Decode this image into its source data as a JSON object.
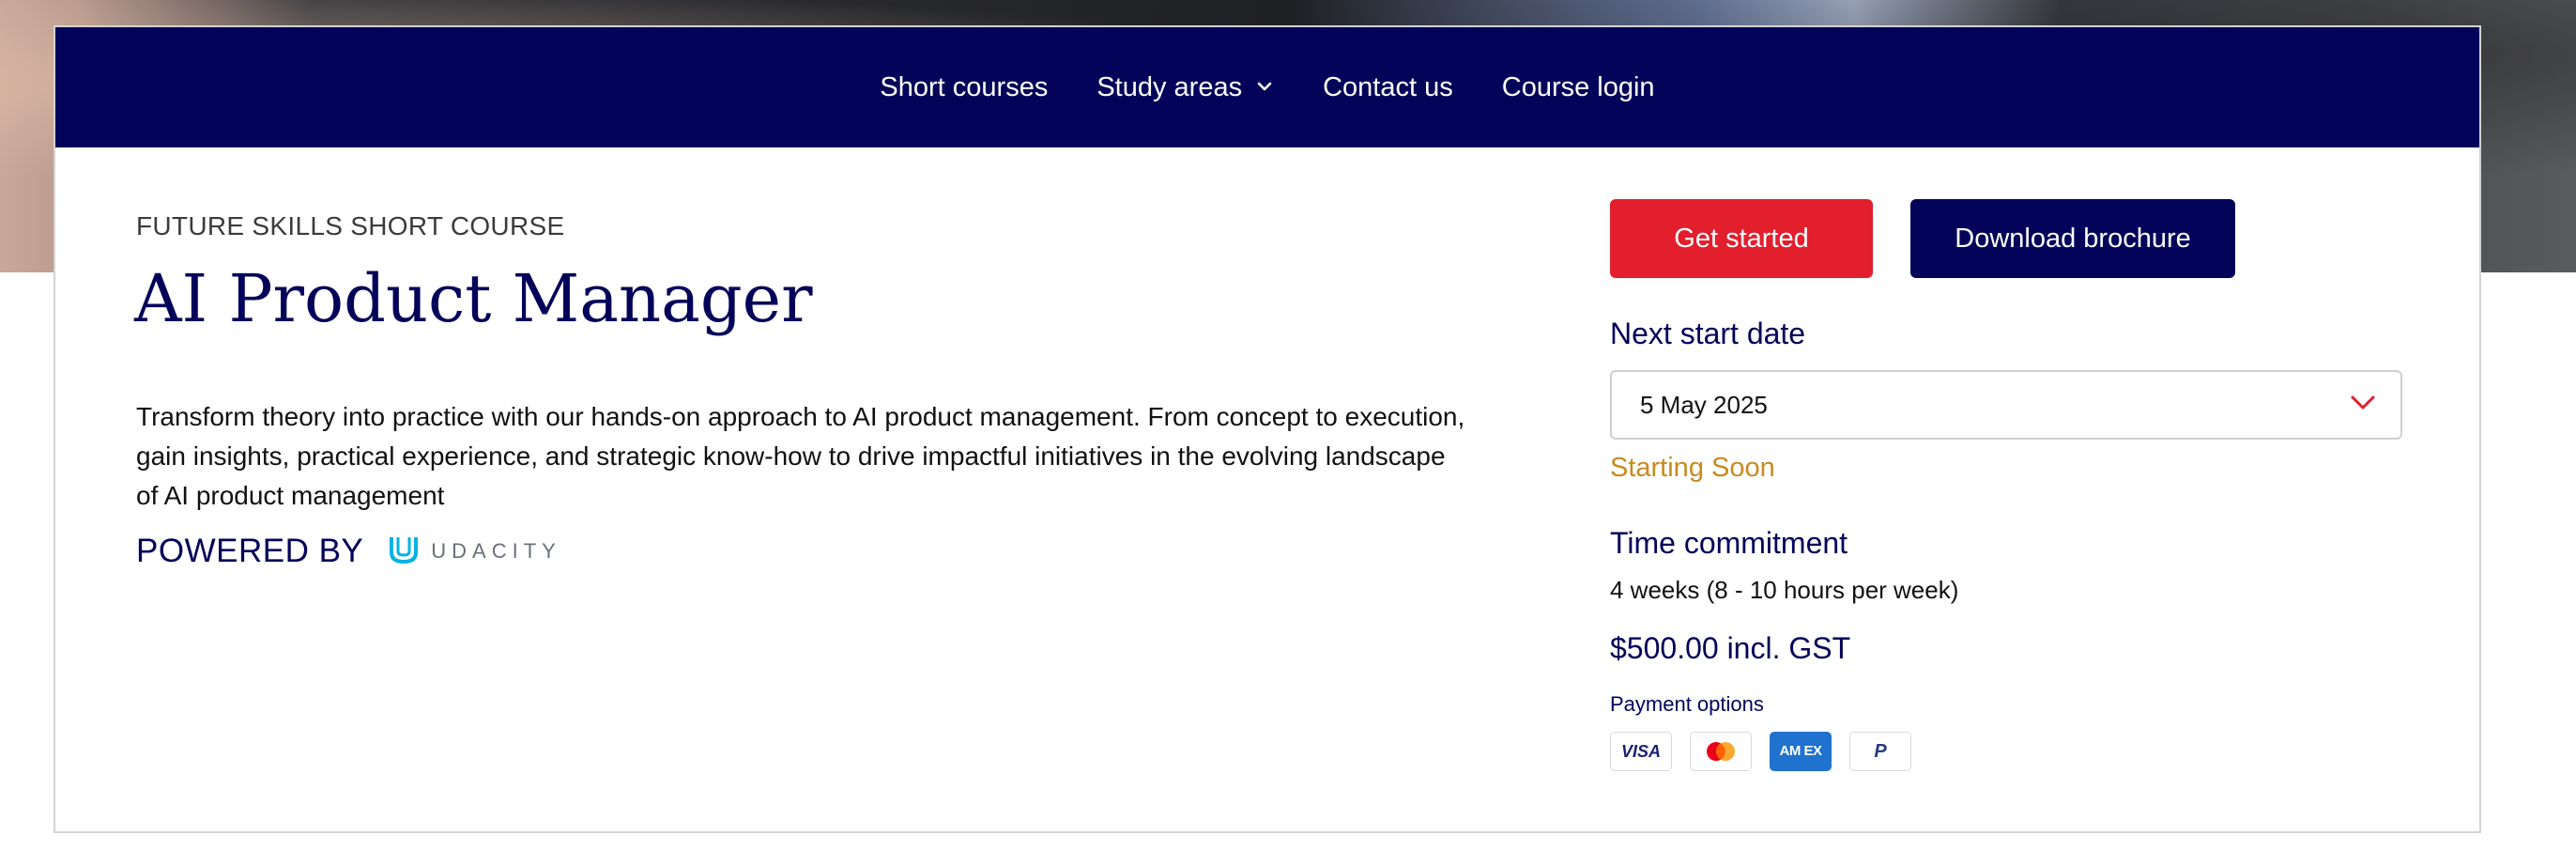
{
  "nav": {
    "items": [
      {
        "label": "Short courses"
      },
      {
        "label": "Study areas",
        "has_dropdown": true
      },
      {
        "label": "Contact us"
      },
      {
        "label": "Course login"
      }
    ]
  },
  "course": {
    "eyebrow": "FUTURE SKILLS SHORT COURSE",
    "title": "AI Product Manager",
    "description": "Transform theory into practice with our hands-on approach to AI product management. From concept to execution, gain insights, practical experience, and strategic know-how to drive impactful initiatives in the evolving landscape of AI product management",
    "powered_by_label": "POWERED BY",
    "partner_logo": {
      "icon": "udacity-logo-icon",
      "text": "UDACITY"
    }
  },
  "actions": {
    "get_started": "Get started",
    "download_brochure": "Download brochure"
  },
  "enrolment": {
    "next_start_label": "Next start date",
    "selected_date": "5 May 2025",
    "status": "Starting Soon",
    "time_label": "Time commitment",
    "time_value": "4 weeks (8 - 10 hours per week)",
    "price": "$500.00 incl. GST",
    "payment_label": "Payment options",
    "payment_methods": [
      "visa-icon",
      "mastercard-icon",
      "amex-icon",
      "paypal-icon"
    ],
    "visa_text": "VISA",
    "amex_text": "AM EX",
    "paypal_text": "P"
  },
  "colors": {
    "navy": "#03035a",
    "accent_red": "#e31e2d",
    "status_orange": "#c98a1e"
  }
}
